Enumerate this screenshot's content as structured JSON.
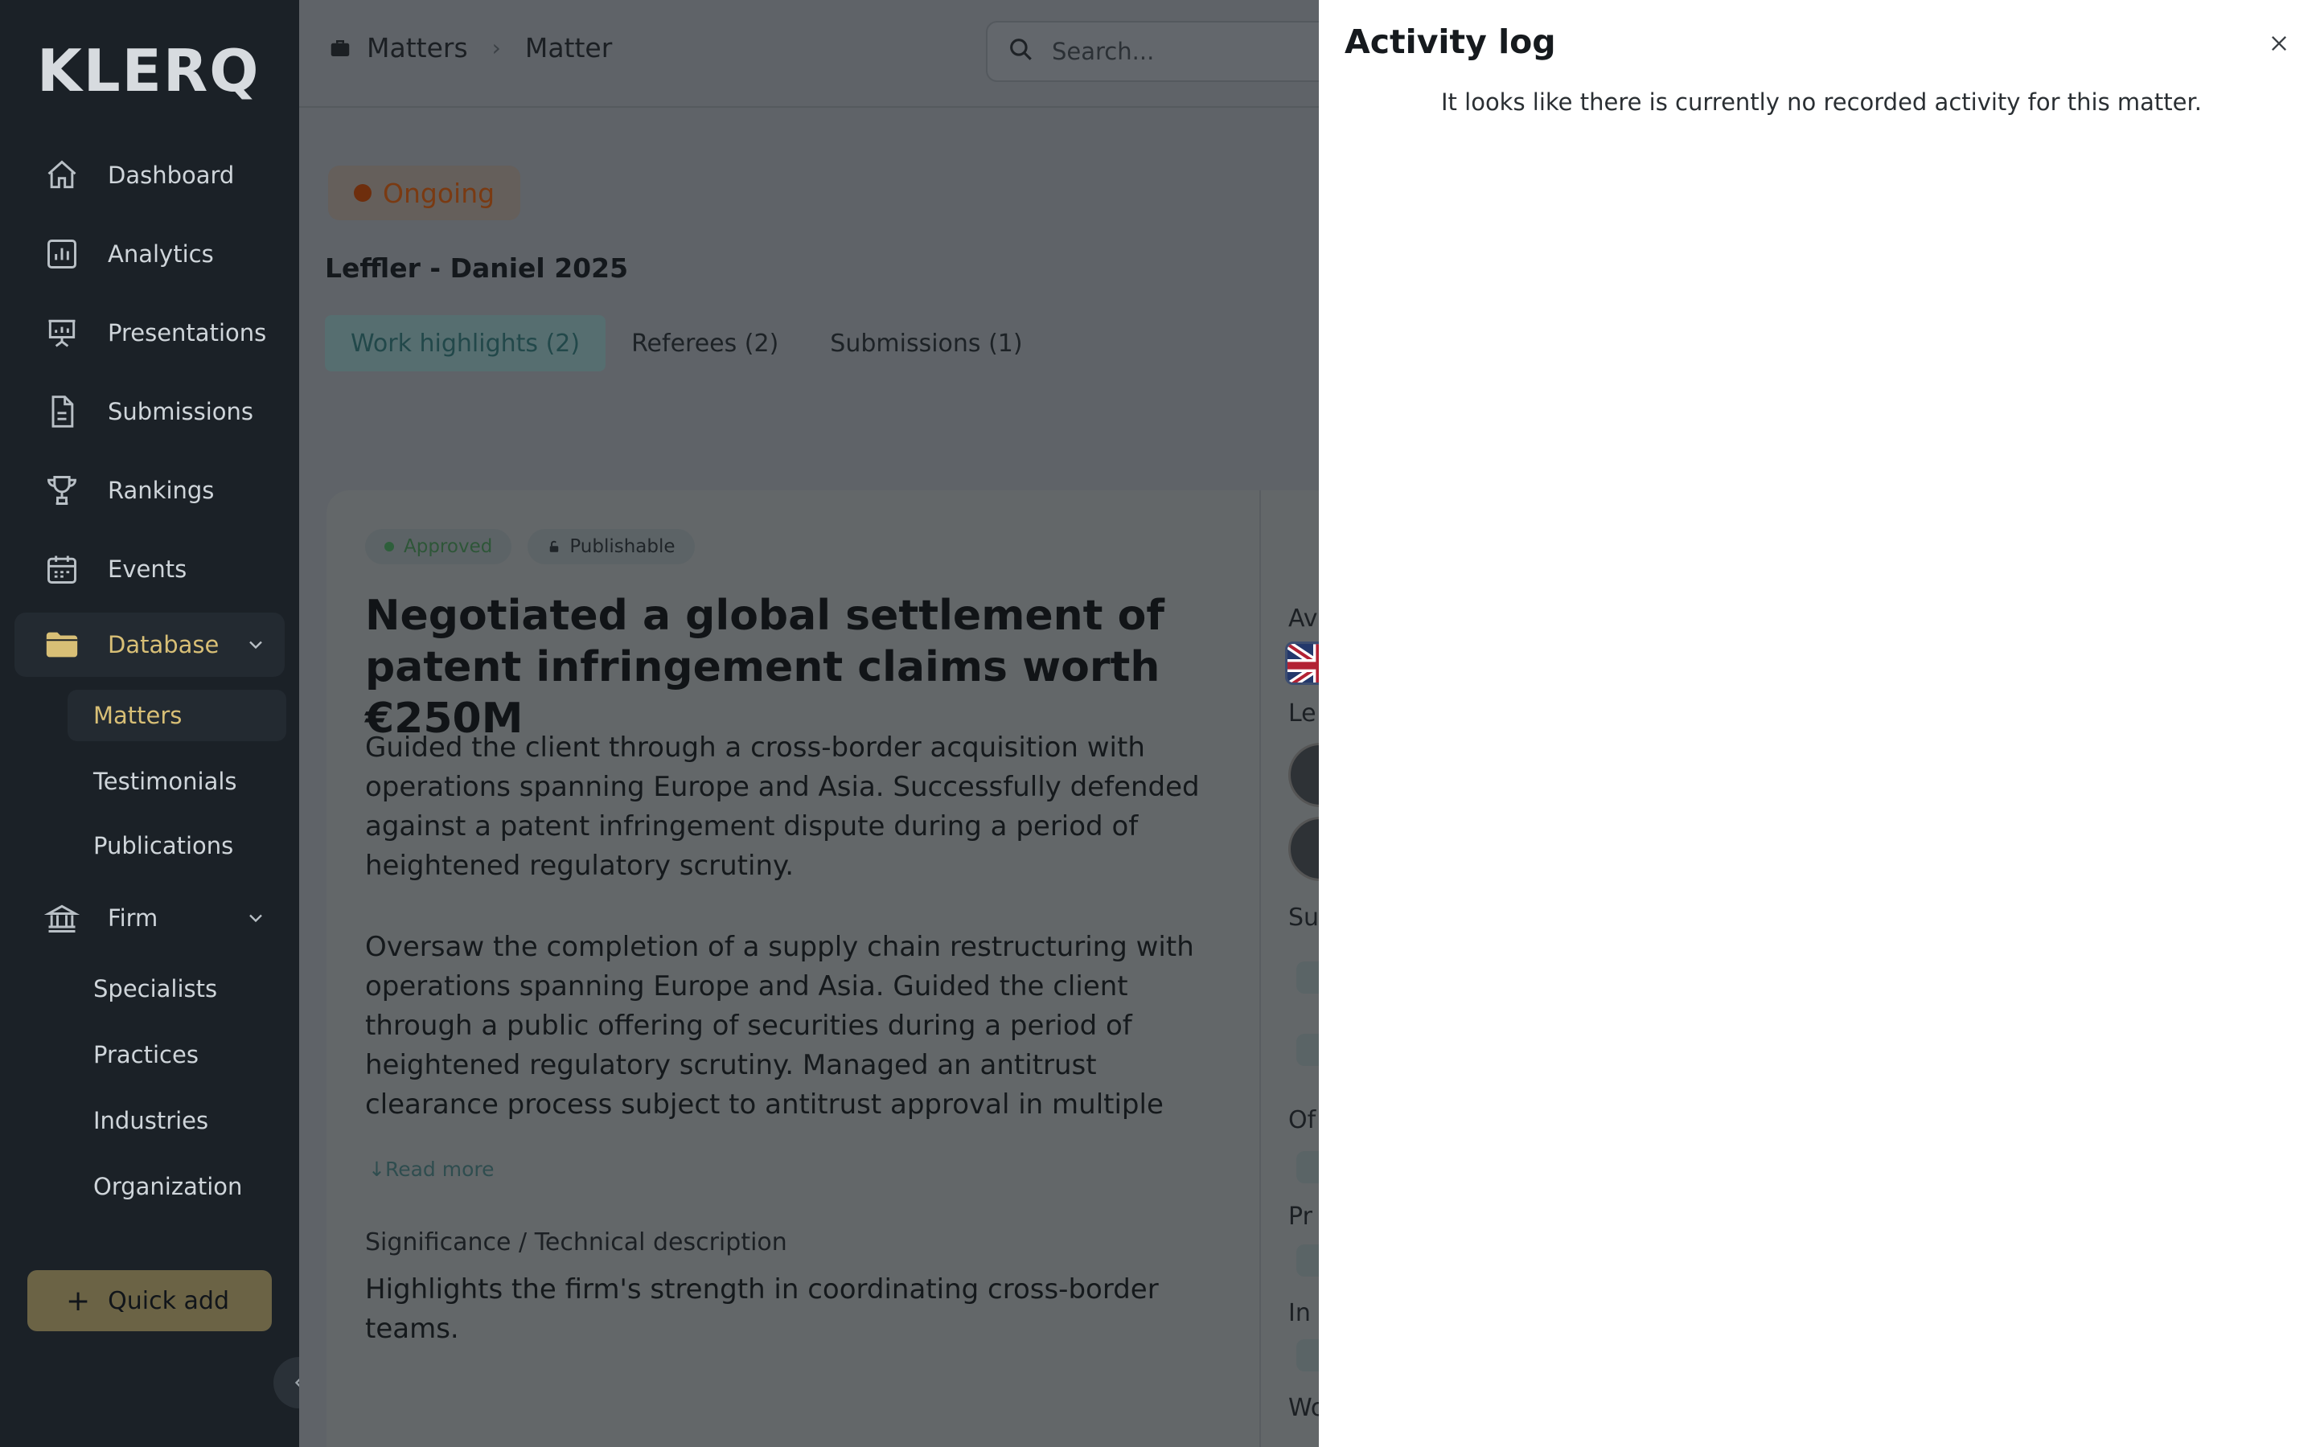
{
  "app": {
    "logo": "KLERQ"
  },
  "sidebar": {
    "items": [
      {
        "label": "Dashboard",
        "icon": "home-icon"
      },
      {
        "label": "Analytics",
        "icon": "bar-chart-icon"
      },
      {
        "label": "Presentations",
        "icon": "presentation-icon"
      },
      {
        "label": "Submissions",
        "icon": "document-icon"
      },
      {
        "label": "Rankings",
        "icon": "trophy-icon"
      },
      {
        "label": "Events",
        "icon": "calendar-icon"
      },
      {
        "label": "Database",
        "icon": "folder-icon",
        "active": true
      },
      {
        "label": "Firm",
        "icon": "bank-icon"
      }
    ],
    "database_sub": [
      "Matters",
      "Testimonials",
      "Publications"
    ],
    "firm_sub": [
      "Specialists",
      "Practices",
      "Industries",
      "Organization"
    ],
    "quick_add": "Quick add",
    "accent_color": "#d8bf76"
  },
  "header": {
    "breadcrumb": [
      "Matters",
      "Matter"
    ],
    "search_placeholder": "Search..."
  },
  "matter": {
    "status": "Ongoing",
    "title": "Leffler - Daniel 2025",
    "tabs": [
      "Work highlights (2)",
      "Referees (2)",
      "Submissions (1)"
    ],
    "active_tab": 0,
    "highlight": {
      "badges": [
        "Approved",
        "Publishable"
      ],
      "heading": "Negotiated a global settlement of patent infringement claims worth €250M",
      "paragraph1": "Guided the client through a cross-border acquisition with operations spanning Europe and Asia. Successfully defended against a patent infringement dispute during a period of heightened regulatory scrutiny.",
      "paragraph2": "Oversaw the completion of a supply chain restructuring with operations spanning Europe and Asia. Guided the client through a public offering of securities during a period of heightened regulatory scrutiny. Managed an antitrust clearance process subject to antitrust approval in multiple jurisdictions. Led the due",
      "read_more": "Read more",
      "significance_label": "Significance / Technical description",
      "significance_text": "Highlights the firm's strength in coordinating cross-border teams."
    },
    "side_peek": [
      "Av",
      "Le",
      "Su",
      "Of",
      "Pr",
      "In",
      "Wo"
    ]
  },
  "drawer": {
    "title": "Activity log",
    "empty_message": "It looks like there is currently no recorded activity for this matter."
  }
}
